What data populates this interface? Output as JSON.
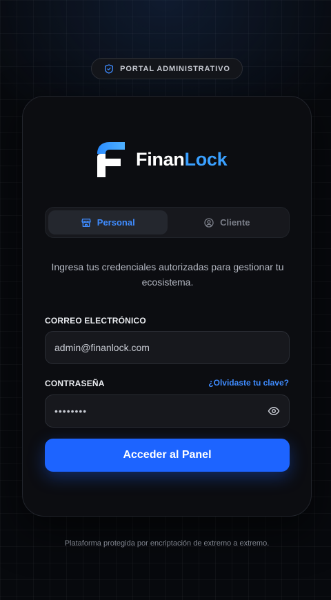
{
  "badge": {
    "label": "PORTAL ADMINISTRATIVO",
    "icon": "shield-check-icon"
  },
  "brand": {
    "name_primary": "Finan",
    "name_accent": "Lock",
    "accent_color": "#3aa0ff",
    "logo_icon": "f-logo-icon"
  },
  "tabs": [
    {
      "label": "Personal",
      "icon": "store-icon",
      "active": true
    },
    {
      "label": "Cliente",
      "icon": "user-circle-icon",
      "active": false
    }
  ],
  "description": "Ingresa tus credenciales autorizadas para gestionar tu ecosistema.",
  "email": {
    "label": "CORREO ELECTRÓNICO",
    "value": "admin@finanlock.com"
  },
  "password": {
    "label": "CONTRASEÑA",
    "value": "••••••••",
    "forgot_link": "¿Olvidaste tu clave?",
    "toggle_icon": "eye-icon"
  },
  "submit": {
    "label": "Acceder al Panel",
    "color": "#1d64ff"
  },
  "footer": {
    "text": "Plataforma protegida por encriptación de extremo a extremo."
  }
}
